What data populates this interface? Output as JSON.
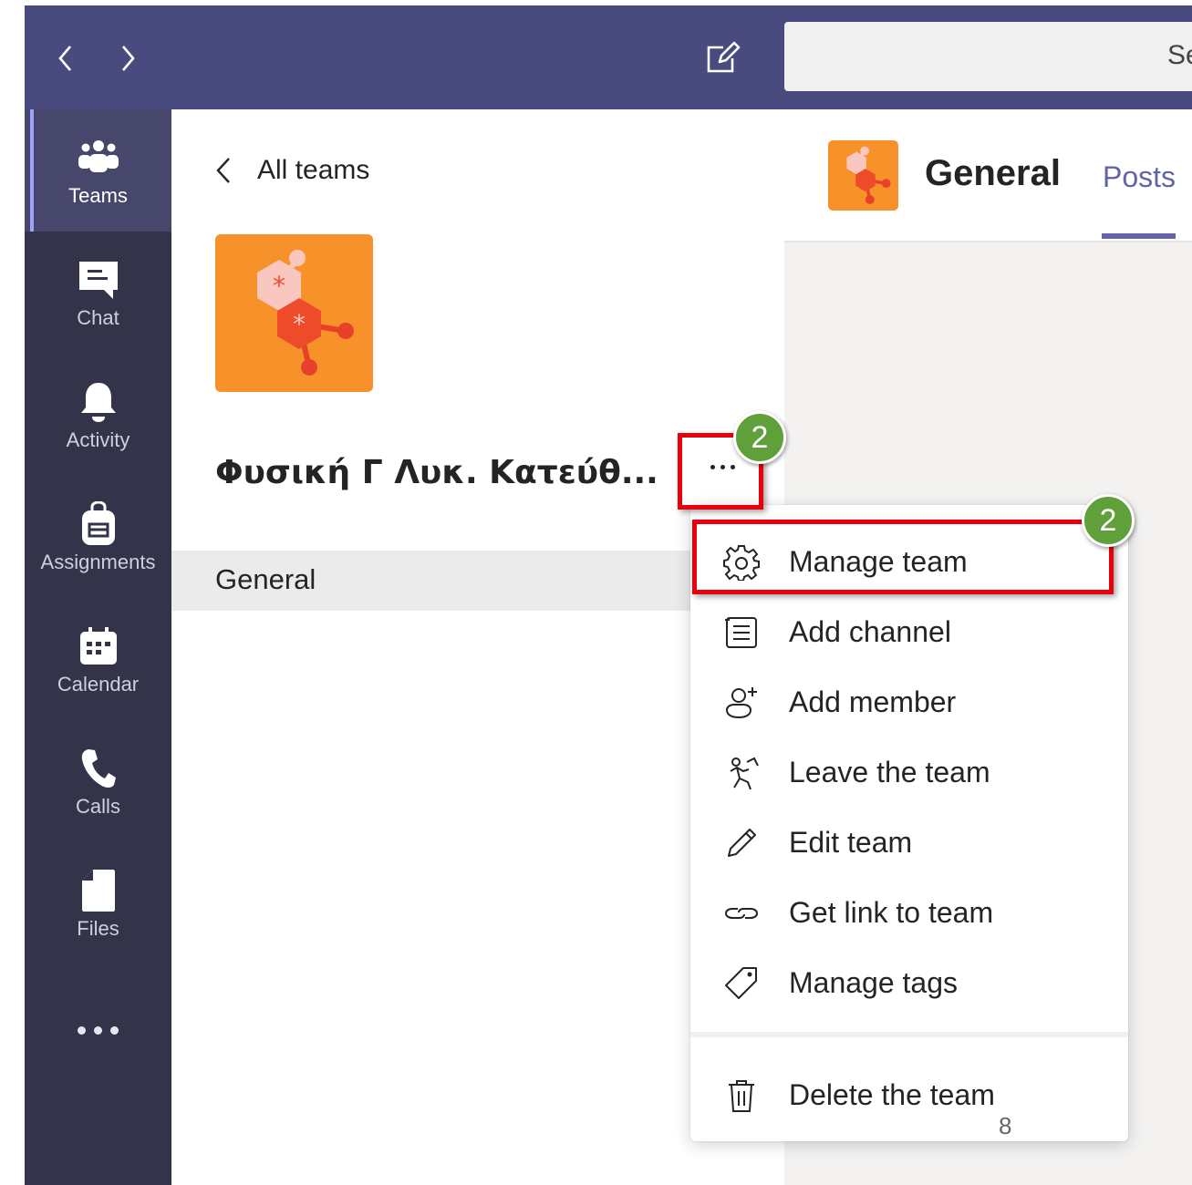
{
  "search": {
    "text": "Se"
  },
  "rail": {
    "items": [
      {
        "label": "Teams",
        "icon": "teams-icon"
      },
      {
        "label": "Chat",
        "icon": "chat-icon"
      },
      {
        "label": "Activity",
        "icon": "bell-icon"
      },
      {
        "label": "Assignments",
        "icon": "backpack-icon"
      },
      {
        "label": "Calendar",
        "icon": "calendar-icon"
      },
      {
        "label": "Calls",
        "icon": "phone-icon"
      },
      {
        "label": "Files",
        "icon": "file-icon"
      }
    ],
    "more": "ellipsis-icon"
  },
  "panel": {
    "back_label": "All teams",
    "team_name": "Φυσική Γ Λυκ. Κατεύθ...",
    "channel": "General"
  },
  "channel_header": {
    "title": "General",
    "tab": "Posts"
  },
  "menu": {
    "items": [
      {
        "label": "Manage team",
        "icon": "gear-icon"
      },
      {
        "label": "Add channel",
        "icon": "add-channel-icon"
      },
      {
        "label": "Add member",
        "icon": "add-member-icon"
      },
      {
        "label": "Leave the team",
        "icon": "leave-icon"
      },
      {
        "label": "Edit team",
        "icon": "pencil-icon"
      },
      {
        "label": "Get link to team",
        "icon": "link-icon"
      },
      {
        "label": "Manage tags",
        "icon": "tag-icon"
      },
      {
        "label": "Delete the team",
        "icon": "trash-icon"
      }
    ]
  },
  "annotations": {
    "badge_1": "2",
    "badge_2": "2",
    "highlight_color": "#e8000b",
    "badge_color": "#5fa03b"
  },
  "slide_number": "8",
  "colors": {
    "topbar": "#494a7e",
    "rail": "#33344a",
    "accent": "#6264a7",
    "team_logo": "#f7922a"
  }
}
